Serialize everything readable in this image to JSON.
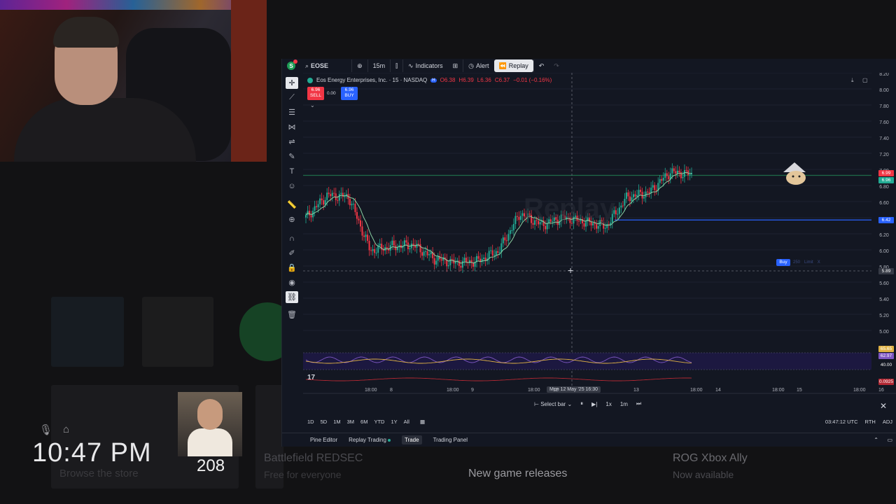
{
  "overlay": {
    "clock": "10:47 PM",
    "browse_store": "Browse the store",
    "count": "208",
    "tiles": [
      {
        "title": "Battlefield REDSEC",
        "subtitle": "Free for everyone"
      },
      {
        "title": "New game releases",
        "subtitle": ""
      },
      {
        "title": "ROG Xbox Ally",
        "subtitle": "Now available"
      }
    ],
    "mic_icon": "mic-muted-icon",
    "cast_icon": "cast-icon"
  },
  "toolbar": {
    "symbol": "EOSE",
    "interval": "15m",
    "indicators": "Indicators",
    "alert": "Alert",
    "replay": "Replay"
  },
  "legend": {
    "name": "Eos Energy Enterprises, Inc. · 15 · NASDAQ",
    "o": "O6.38",
    "h": "H6.39",
    "l": "L6.36",
    "c": "C6.37",
    "chg": "−0.01 (−0.16%)",
    "sell_price": "6.96",
    "sell_label": "SELL",
    "spread": "0.00",
    "buy_price": "6.96",
    "buy_label": "BUY"
  },
  "watermark": "Replay",
  "price_axis": [
    "8.20",
    "8.00",
    "7.80",
    "7.60",
    "7.40",
    "7.20",
    "7.00",
    "6.80",
    "6.60",
    "6.40",
    "6.20",
    "6.00",
    "5.80",
    "5.60",
    "5.40",
    "5.20",
    "5.00"
  ],
  "price_tags": {
    "current_red": "6.99",
    "current_green": "6.96",
    "blue_line": "6.42",
    "cross": "5.89",
    "rsi_1": "65.65",
    "rsi_2": "62.97",
    "rsi_mid": "40.00",
    "macd": "0.0925"
  },
  "order": {
    "buy": "Buy",
    "qty": "250",
    "type": "Limit",
    "close": "X"
  },
  "x_axis": [
    "18:00",
    "8",
    "18:00",
    "9",
    "18:00",
    "12",
    "13",
    "18:00",
    "14",
    "18:00",
    "15",
    "18:00",
    "16"
  ],
  "crosshair_date": "Mon 12 May '25  16:30",
  "replay_controls": {
    "select_bar": "Select bar",
    "speed": "1x",
    "interval": "1m"
  },
  "ranges": [
    "1D",
    "5D",
    "1M",
    "3M",
    "6M",
    "YTD",
    "1Y",
    "All"
  ],
  "status": {
    "time": "03:47:12 UTC",
    "session": "RTH",
    "adj": "ADJ"
  },
  "bottom_tabs": [
    "Pine Editor",
    "Replay Trading",
    "Trade",
    "Trading Panel"
  ],
  "chart_data": {
    "type": "line",
    "title": "",
    "xlabel": "",
    "ylabel": "",
    "ylim": [
      5.0,
      8.2
    ],
    "x": [
      "May 7 18:00",
      "May 8",
      "May 8 18:00",
      "May 9",
      "May 9 18:00",
      "May 12",
      "May 12 18:00",
      "May 13",
      "May 13 18:00",
      "May 14"
    ],
    "series": [
      {
        "values": [
          6.45,
          6.72,
          6.7,
          6.05,
          6.1,
          6.12,
          5.95,
          5.9,
          5.92,
          6.05,
          6.5,
          6.36,
          6.45,
          6.4,
          6.34,
          6.7,
          6.75,
          7.0,
          6.97
        ]
      }
    ],
    "horizontal_lines": [
      {
        "value": 6.42,
        "color": "#2962ff"
      },
      {
        "value": 6.96,
        "color": "#1e6b4a"
      }
    ],
    "colors": {
      "up": "#22ab94",
      "down": "#f23645",
      "ma": "#8bd0a2"
    }
  }
}
